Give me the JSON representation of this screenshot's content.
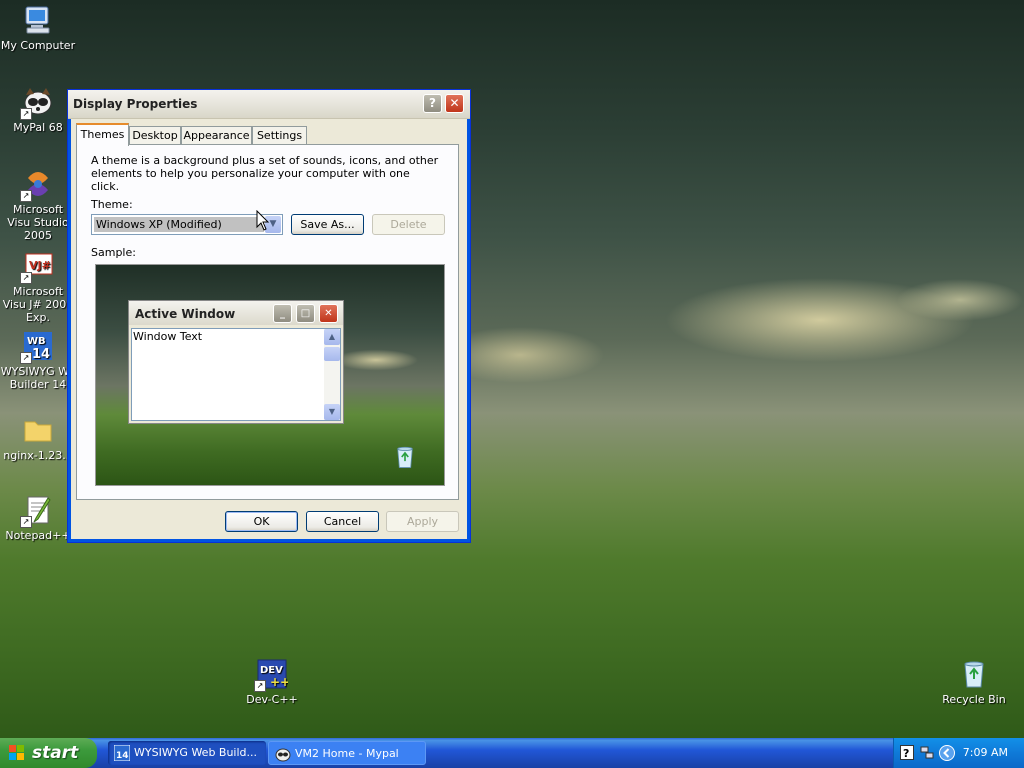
{
  "desktop": {
    "icons": [
      {
        "label": "My Computer"
      },
      {
        "label": "MyPal 68"
      },
      {
        "label": "Microsoft Visu Studio 2005"
      },
      {
        "label": "Microsoft Visu J# 2005 Exp."
      },
      {
        "label": "WYSIWYG We Builder 14"
      },
      {
        "label": "nginx-1.23..."
      },
      {
        "label": "Notepad++"
      },
      {
        "label": "Dev-C++"
      },
      {
        "label": "Recycle Bin"
      }
    ]
  },
  "dialog": {
    "title": "Display Properties",
    "help_glyph": "?",
    "close_glyph": "✕",
    "tabs": [
      {
        "label": "Themes"
      },
      {
        "label": "Desktop"
      },
      {
        "label": "Appearance"
      },
      {
        "label": "Settings"
      }
    ],
    "description": "A theme is a background plus a set of sounds, icons, and other elements to help you personalize your computer with one click.",
    "theme_label": "Theme:",
    "theme_value": "Windows XP (Modified)",
    "save_as_label": "Save As...",
    "delete_label": "Delete",
    "sample_label": "Sample:",
    "sample_window": {
      "title": "Active Window",
      "body_text": "Window Text"
    },
    "ok_label": "OK",
    "cancel_label": "Cancel",
    "apply_label": "Apply"
  },
  "taskbar": {
    "start_label": "start",
    "tasks": [
      {
        "label": "WYSIWYG Web Build...",
        "active": true
      },
      {
        "label": "VM2 Home - Mypal",
        "active": false
      }
    ],
    "clock": "7:09 AM"
  }
}
